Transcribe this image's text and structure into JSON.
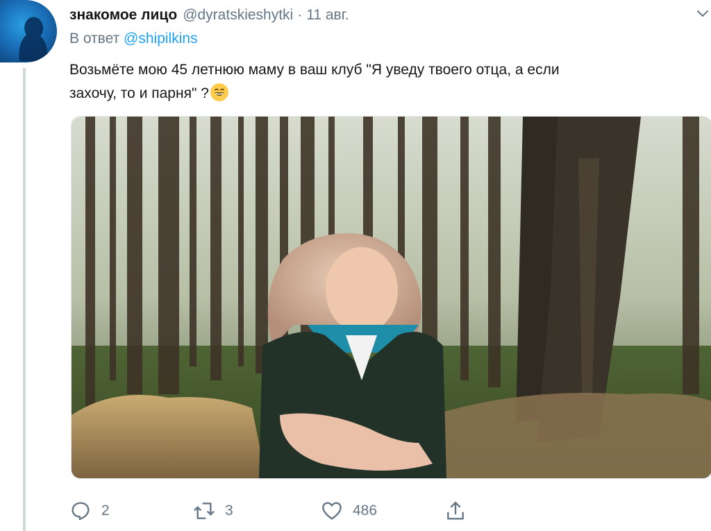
{
  "author": {
    "display_name": "знакомое лицо",
    "handle": "@dyratskieshytki",
    "separator": "·",
    "timestamp": "11 авг."
  },
  "reply": {
    "prefix": "В ответ",
    "mention": "@shipilkins"
  },
  "tweet": {
    "line1": "Возьмёте мою 45 летнюю маму в ваш клуб \"Я уведу твоего отца, а если",
    "line2": "захочу, то и парня\" ?"
  },
  "actions": {
    "replies": "2",
    "retweets": "3",
    "likes": "486"
  },
  "icons": [
    "avatar",
    "chevron-down-icon",
    "grinning-emoji",
    "reply-icon",
    "retweet-icon",
    "like-icon",
    "share-icon"
  ],
  "colors": {
    "link": "#1da1f2",
    "secondary_text": "#657786",
    "primary_text": "#14171a",
    "thread_line": "#cfd9de"
  }
}
